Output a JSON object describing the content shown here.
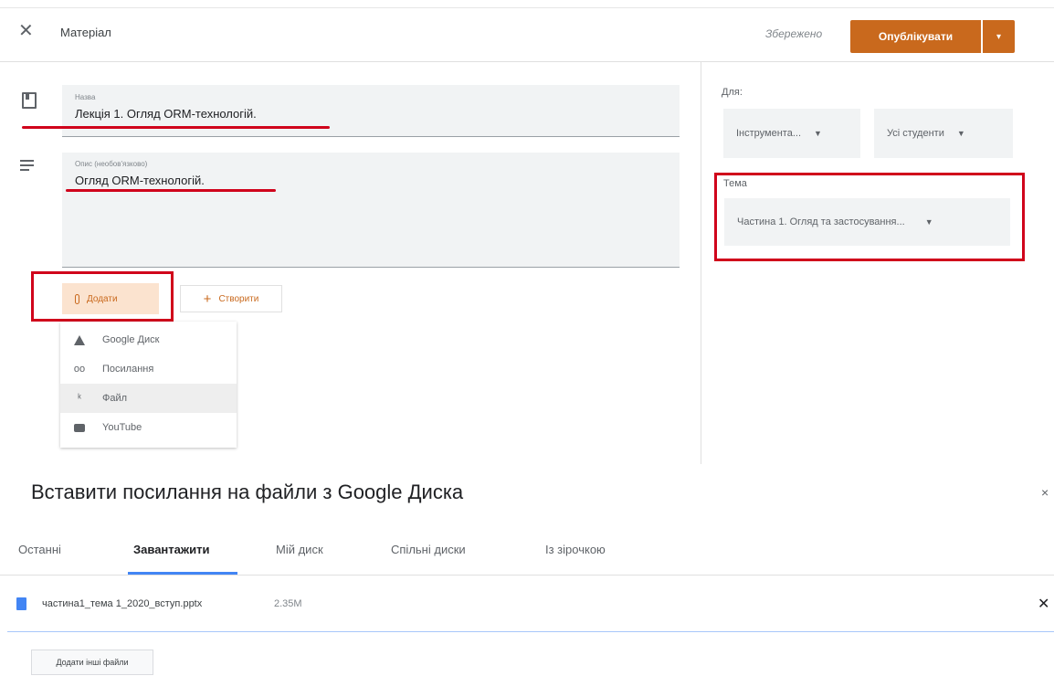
{
  "header": {
    "title": "Матеріал",
    "saved_status": "Збережено",
    "publish_label": "Опублікувати",
    "publish_dropdown_glyph": "▾",
    "close_glyph": "✕"
  },
  "form": {
    "title_label": "Назва",
    "title_value": "Лекція 1. Огляд ORM-технологій.",
    "description_label": "Опис (необов'язково)",
    "description_value": "Огляд ORM-технологій."
  },
  "actions": {
    "add_label": "Додати",
    "create_label": "Створити",
    "create_glyph": "+"
  },
  "add_menu": {
    "items": [
      {
        "label": "Google Диск",
        "icon": "google-drive-icon"
      },
      {
        "label": "Посилання",
        "icon": "link-icon"
      },
      {
        "label": "Файл",
        "icon": "paperclip-icon"
      },
      {
        "label": "YouTube",
        "icon": "youtube-icon"
      }
    ],
    "selected": "Файл"
  },
  "sidebar": {
    "for_label": "Для:",
    "course_value": "Інструмента...",
    "students_value": "Усі студенти",
    "topic_label": "Тема",
    "topic_value": "Частина 1. Огляд та застосування..."
  },
  "dialog": {
    "title": "Вставити посилання на файли з Google Диска",
    "close_glyph": "×",
    "tabs": [
      "Останні",
      "Завантажити",
      "Мій диск",
      "Спільні диски",
      "Із зірочкою"
    ],
    "active_tab": "Завантажити",
    "file": {
      "name": "частина1_тема 1_2020_вступ.pptx",
      "size": "2.35M",
      "remove_glyph": "✕"
    },
    "add_more_label": "Додати інші файли"
  },
  "colors": {
    "accent": "#c9691d",
    "annotation_red": "#d0021b",
    "tab_active_blue": "#4285f4"
  }
}
